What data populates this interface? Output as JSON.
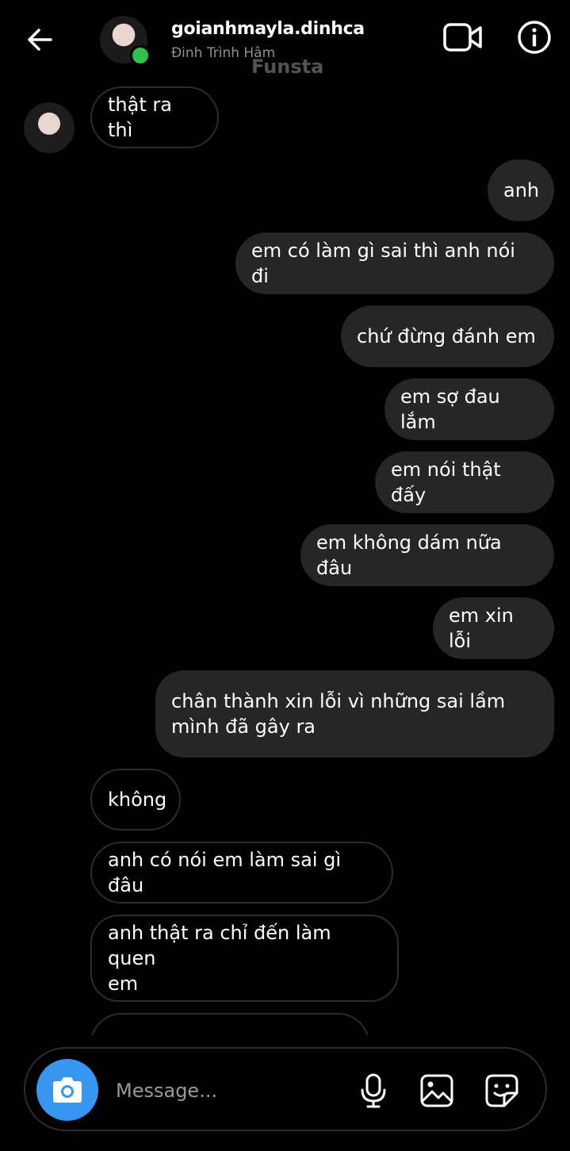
{
  "header": {
    "username": "goianhmayla.dinhca",
    "full_name": "Đinh Trình Hâm",
    "watermark": "Funsta",
    "online_color": "#2ec24b",
    "icons": [
      "back-arrow-icon",
      "video-call-icon",
      "info-icon"
    ]
  },
  "messages": [
    {
      "text": "thật ra thì",
      "from": "them"
    },
    {
      "text": "anh",
      "from": "me"
    },
    {
      "text": "em có làm gì sai thì anh nói đi",
      "from": "me"
    },
    {
      "text": "chứ đừng đánh em",
      "from": "me"
    },
    {
      "text": "em sợ đau lắm",
      "from": "me"
    },
    {
      "text": "em nói thật đấy",
      "from": "me"
    },
    {
      "text": "em không dám nữa đâu",
      "from": "me"
    },
    {
      "text": "em xin lỗi",
      "from": "me"
    },
    {
      "text": "chân thành xin lỗi vì những sai lầm\nmình đã gây ra",
      "from": "me"
    },
    {
      "text": "không",
      "from": "them"
    },
    {
      "text": "anh có nói em làm sai gì đâu",
      "from": "them"
    },
    {
      "text": "anh thật ra chỉ đến làm quen\nem",
      "from": "them"
    },
    {
      "text": "",
      "from": "them"
    }
  ],
  "composer": {
    "placeholder": "Message...",
    "accent_color": "#3797f0",
    "icons": [
      "camera-icon",
      "microphone-icon",
      "gallery-icon",
      "sticker-icon"
    ]
  }
}
